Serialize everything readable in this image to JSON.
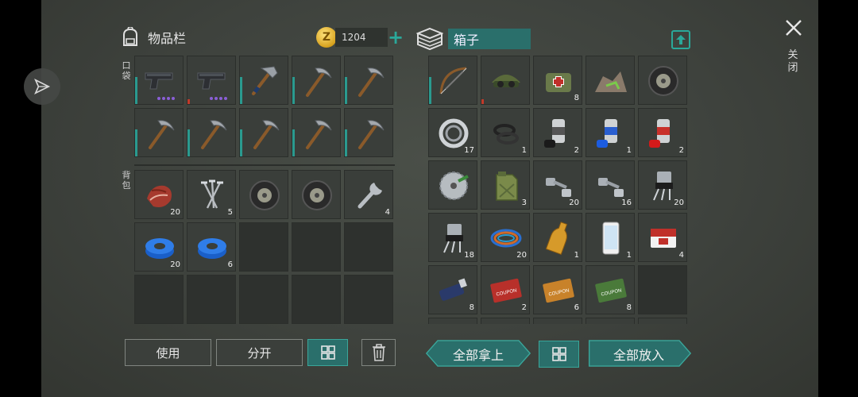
{
  "inventory": {
    "title": "物品栏",
    "section_pocket": "口袋",
    "section_backpack": "背包"
  },
  "coins": {
    "value": "1204",
    "plus": "+",
    "symbol": "Z"
  },
  "box": {
    "name": "箱子"
  },
  "close": {
    "label": "关闭"
  },
  "buttons": {
    "use": "使用",
    "split": "分开",
    "take_all": "全部拿上",
    "put_all": "全部放入"
  },
  "pocket": [
    {
      "item": "pistol",
      "dots": 4,
      "bar": "teal"
    },
    {
      "item": "pistol",
      "dots": 4,
      "bar": "red"
    },
    {
      "item": "hammer",
      "bar": "teal"
    },
    {
      "item": "pickaxe",
      "bar": "teal"
    },
    {
      "item": "pickaxe",
      "bar": "teal"
    },
    {
      "item": "pickaxe",
      "bar": "teal"
    },
    {
      "item": "pickaxe",
      "bar": "teal"
    },
    {
      "item": "pickaxe",
      "bar": "teal"
    },
    {
      "item": "pickaxe",
      "bar": "teal"
    },
    {
      "item": "pickaxe",
      "bar": "teal"
    }
  ],
  "backpack": [
    {
      "item": "raw-meat",
      "qty": "20"
    },
    {
      "item": "nails",
      "qty": "5"
    },
    {
      "item": "tire",
      "qty": ""
    },
    {
      "item": "tire",
      "qty": ""
    },
    {
      "item": "wrench",
      "qty": "4"
    },
    {
      "item": "duct-tape",
      "qty": "20"
    },
    {
      "item": "duct-tape",
      "qty": "6"
    },
    {
      "item": "",
      "qty": ""
    },
    {
      "item": "",
      "qty": ""
    },
    {
      "item": "",
      "qty": ""
    },
    {
      "item": "",
      "qty": ""
    },
    {
      "item": "",
      "qty": ""
    },
    {
      "item": "",
      "qty": ""
    },
    {
      "item": "",
      "qty": ""
    },
    {
      "item": "",
      "qty": ""
    }
  ],
  "box_items": [
    {
      "item": "bow",
      "qty": "",
      "bar": "teal"
    },
    {
      "item": "goggles-hat",
      "qty": "",
      "bar": "red"
    },
    {
      "item": "medkit-bag",
      "qty": "8"
    },
    {
      "item": "scrap-pile",
      "qty": ""
    },
    {
      "item": "tire",
      "qty": ""
    },
    {
      "item": "bearing",
      "qty": "17"
    },
    {
      "item": "rubber-rings",
      "qty": "1"
    },
    {
      "item": "paint-black",
      "qty": "2"
    },
    {
      "item": "paint-blue",
      "qty": "1"
    },
    {
      "item": "paint-red",
      "qty": "2"
    },
    {
      "item": "saw-blade",
      "qty": ""
    },
    {
      "item": "jerrycan",
      "qty": "3"
    },
    {
      "item": "bolts",
      "qty": "20"
    },
    {
      "item": "bolts",
      "qty": "16"
    },
    {
      "item": "transistor",
      "qty": "20"
    },
    {
      "item": "transistor",
      "qty": "18"
    },
    {
      "item": "wire-coil",
      "qty": "20"
    },
    {
      "item": "bottle",
      "qty": "1"
    },
    {
      "item": "smartphone",
      "qty": "1"
    },
    {
      "item": "cigarettes",
      "qty": "4"
    },
    {
      "item": "usb-drive",
      "qty": "8"
    },
    {
      "item": "coupon-red",
      "qty": "2",
      "text": "COUPON"
    },
    {
      "item": "coupon-orange",
      "qty": "6",
      "text": "COUPON"
    },
    {
      "item": "coupon-green",
      "qty": "8",
      "text": "COUPON"
    },
    {
      "item": "",
      "qty": ""
    }
  ],
  "colors": {
    "accent": "#2a6f6b",
    "accent_bright": "#2aa89a",
    "rare_dot": "#8a5fd6",
    "durability_low": "#c23a2a"
  }
}
